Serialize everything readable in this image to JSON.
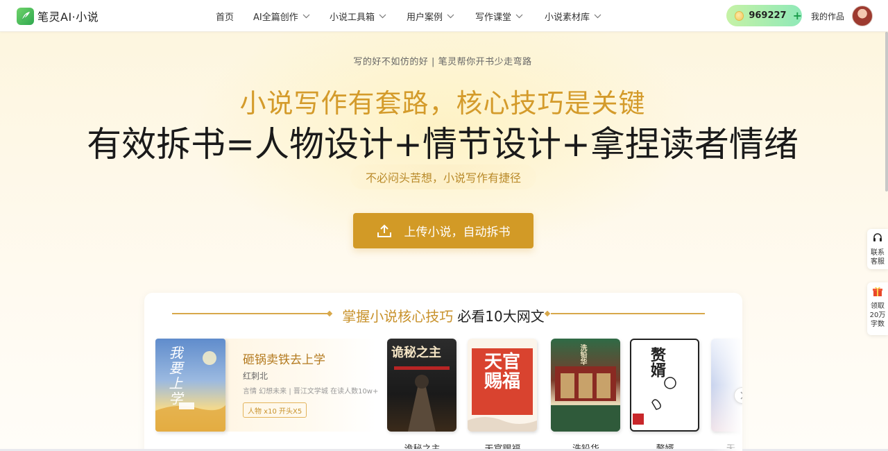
{
  "header": {
    "logo_text": "笔灵AI·小说",
    "nav": [
      {
        "label": "首页",
        "dropdown": false
      },
      {
        "label": "AI全篇创作",
        "dropdown": true
      },
      {
        "label": "小说工具箱",
        "dropdown": true
      },
      {
        "label": "用户案例",
        "dropdown": true
      },
      {
        "label": "写作课堂",
        "dropdown": true
      },
      {
        "label": "小说素材库",
        "dropdown": true
      }
    ],
    "points": "969227",
    "points_add": "+",
    "my_works": "我的作品"
  },
  "hero": {
    "tagline": "写的好不如仿的好 | 笔灵帮你开书少走弯路",
    "title_line1": "小说写作有套路，核心技巧是关键",
    "title_line2": "有效拆书=人物设计+情节设计+拿捏读者情绪",
    "pill": "不必闷头苦想，小说写作有捷径",
    "upload_button": "上传小说，自动拆书"
  },
  "section": {
    "title_highlight": "掌握小说核心技巧",
    "title_rest": "必看10大网文",
    "featured": {
      "cover_text": "我要上学",
      "name": "砸锅卖铁去上学",
      "author": "红刺北",
      "meta": "言情 幻想未来 | 晋江文学城 在读人数10w+",
      "badge": "人物 x10 开头X5"
    },
    "books": [
      {
        "title": "诡秘之主",
        "cover_text": "诡秘之主"
      },
      {
        "title": "天官赐福",
        "cover_text": "天官赐福"
      },
      {
        "title": "洗铅华",
        "cover_text": "洗铅华"
      },
      {
        "title": "赘婿",
        "cover_text": "赘婿"
      },
      {
        "title": "无",
        "cover_text": ""
      }
    ]
  },
  "float": {
    "service": "联系客服",
    "gift": "领取20万字数"
  },
  "colors": {
    "accent_gold": "#d29a26",
    "title_gold": "#d49b2b",
    "points_green": "#1a9c4a"
  }
}
